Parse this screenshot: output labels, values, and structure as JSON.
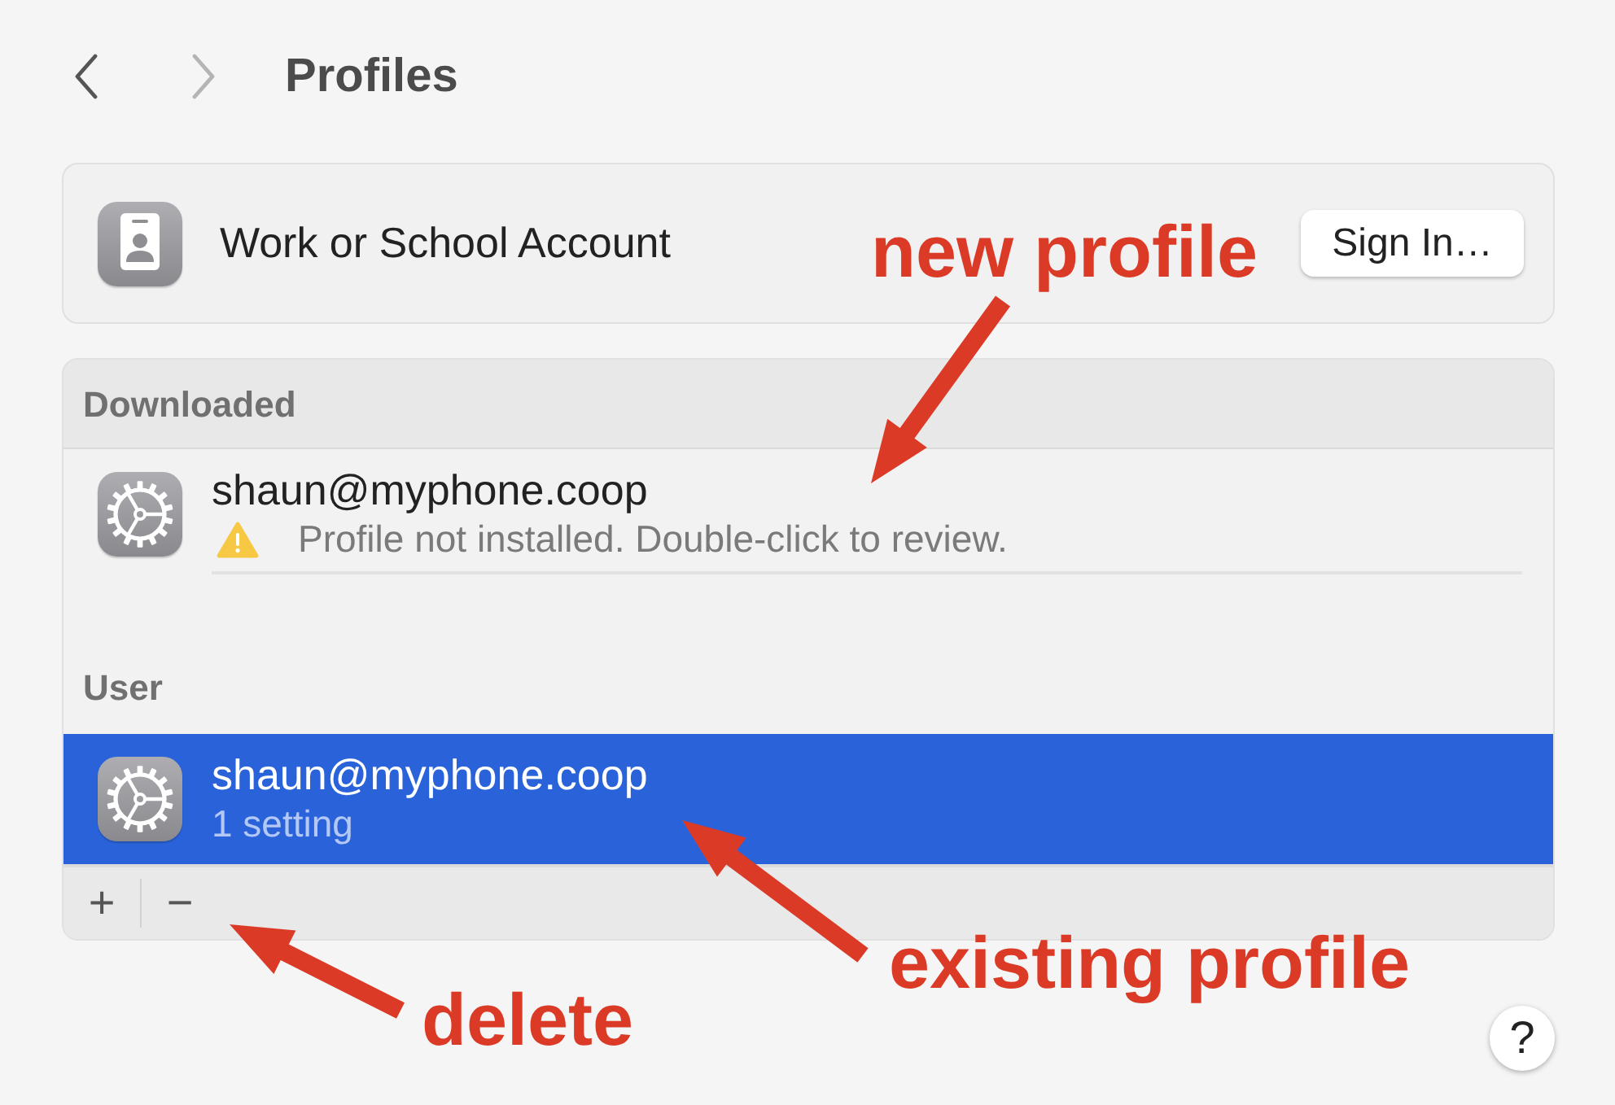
{
  "nav_buttons": [
    {
      "kind": "back",
      "disabled": false
    },
    {
      "kind": "forward",
      "disabled": true
    }
  ],
  "title": "Profiles",
  "account": {
    "label": "Work or School Account",
    "button": "Sign In…"
  },
  "profile_list": {
    "sections": [
      {
        "kind": "header_bar",
        "title": "Downloaded",
        "items": [
          {
            "name": "shaun@myphone.coop",
            "detail": "Profile not installed. Double-click to review.",
            "warning": true,
            "selected": false
          }
        ]
      },
      {
        "kind": "inline",
        "title": "User",
        "items": [
          {
            "name": "shaun@myphone.coop",
            "detail": "1 setting",
            "warning": false,
            "selected": true
          }
        ]
      }
    ],
    "footer_buttons": [
      {
        "kind": "add",
        "label": "+"
      },
      {
        "kind": "remove",
        "label": "−"
      }
    ]
  },
  "help_button": "?",
  "annotations": [
    {
      "text": "new profile"
    },
    {
      "text": "existing profile"
    },
    {
      "text": "delete"
    }
  ]
}
